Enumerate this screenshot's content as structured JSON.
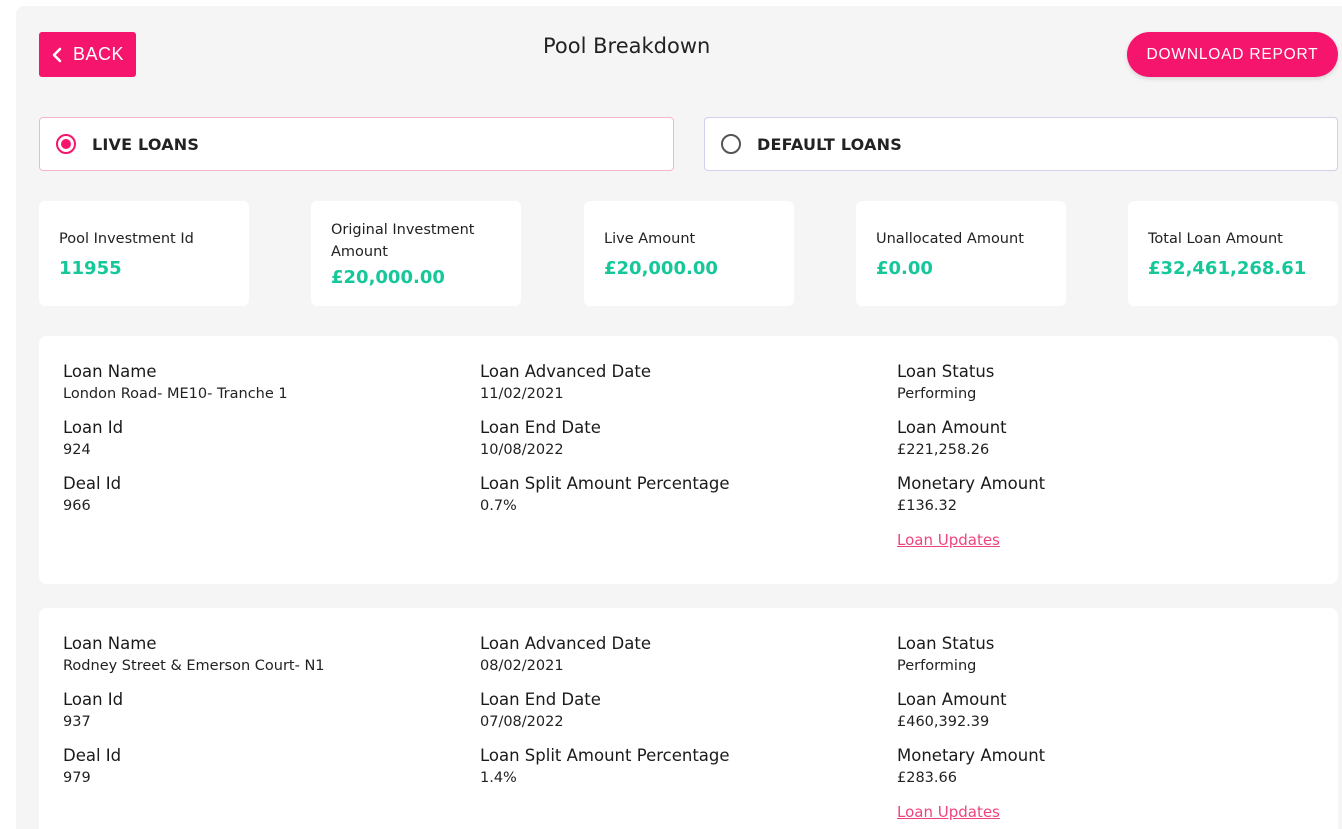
{
  "header": {
    "back_label": "BACK",
    "title": "Pool Breakdown",
    "download_label": "DOWNLOAD REPORT"
  },
  "loan_type": {
    "options": [
      {
        "label": "LIVE LOANS",
        "selected": true
      },
      {
        "label": "DEFAULT LOANS",
        "selected": false
      }
    ]
  },
  "stats": [
    {
      "label": "Pool Investment Id",
      "value": "11955"
    },
    {
      "label": "Original Investment Amount",
      "value": "£20,000.00"
    },
    {
      "label": "Live Amount",
      "value": "£20,000.00"
    },
    {
      "label": "Unallocated Amount",
      "value": "£0.00"
    },
    {
      "label": "Total Loan Amount",
      "value": "£32,461,268.61"
    }
  ],
  "field_labels": {
    "loan_name": "Loan Name",
    "loan_id": "Loan Id",
    "deal_id": "Deal Id",
    "advanced_date": "Loan Advanced Date",
    "end_date": "Loan End Date",
    "split_pct": "Loan Split Amount Percentage",
    "status": "Loan Status",
    "loan_amount": "Loan Amount",
    "monetary_amount": "Monetary Amount",
    "updates_link": "Loan Updates"
  },
  "loans": [
    {
      "loan_name": "London Road- ME10- Tranche 1",
      "loan_id": "924",
      "deal_id": "966",
      "advanced_date": "11/02/2021",
      "end_date": "10/08/2022",
      "split_pct": "0.7%",
      "status": "Performing",
      "loan_amount": "£221,258.26",
      "monetary_amount": "£136.32"
    },
    {
      "loan_name": "Rodney Street & Emerson Court- N1",
      "loan_id": "937",
      "deal_id": "979",
      "advanced_date": "08/02/2021",
      "end_date": "07/08/2022",
      "split_pct": "1.4%",
      "status": "Performing",
      "loan_amount": "£460,392.39",
      "monetary_amount": "£283.66"
    }
  ],
  "colors": {
    "accent": "#f5156c",
    "value_green": "#16c79a",
    "link_pink": "#f0437e"
  }
}
